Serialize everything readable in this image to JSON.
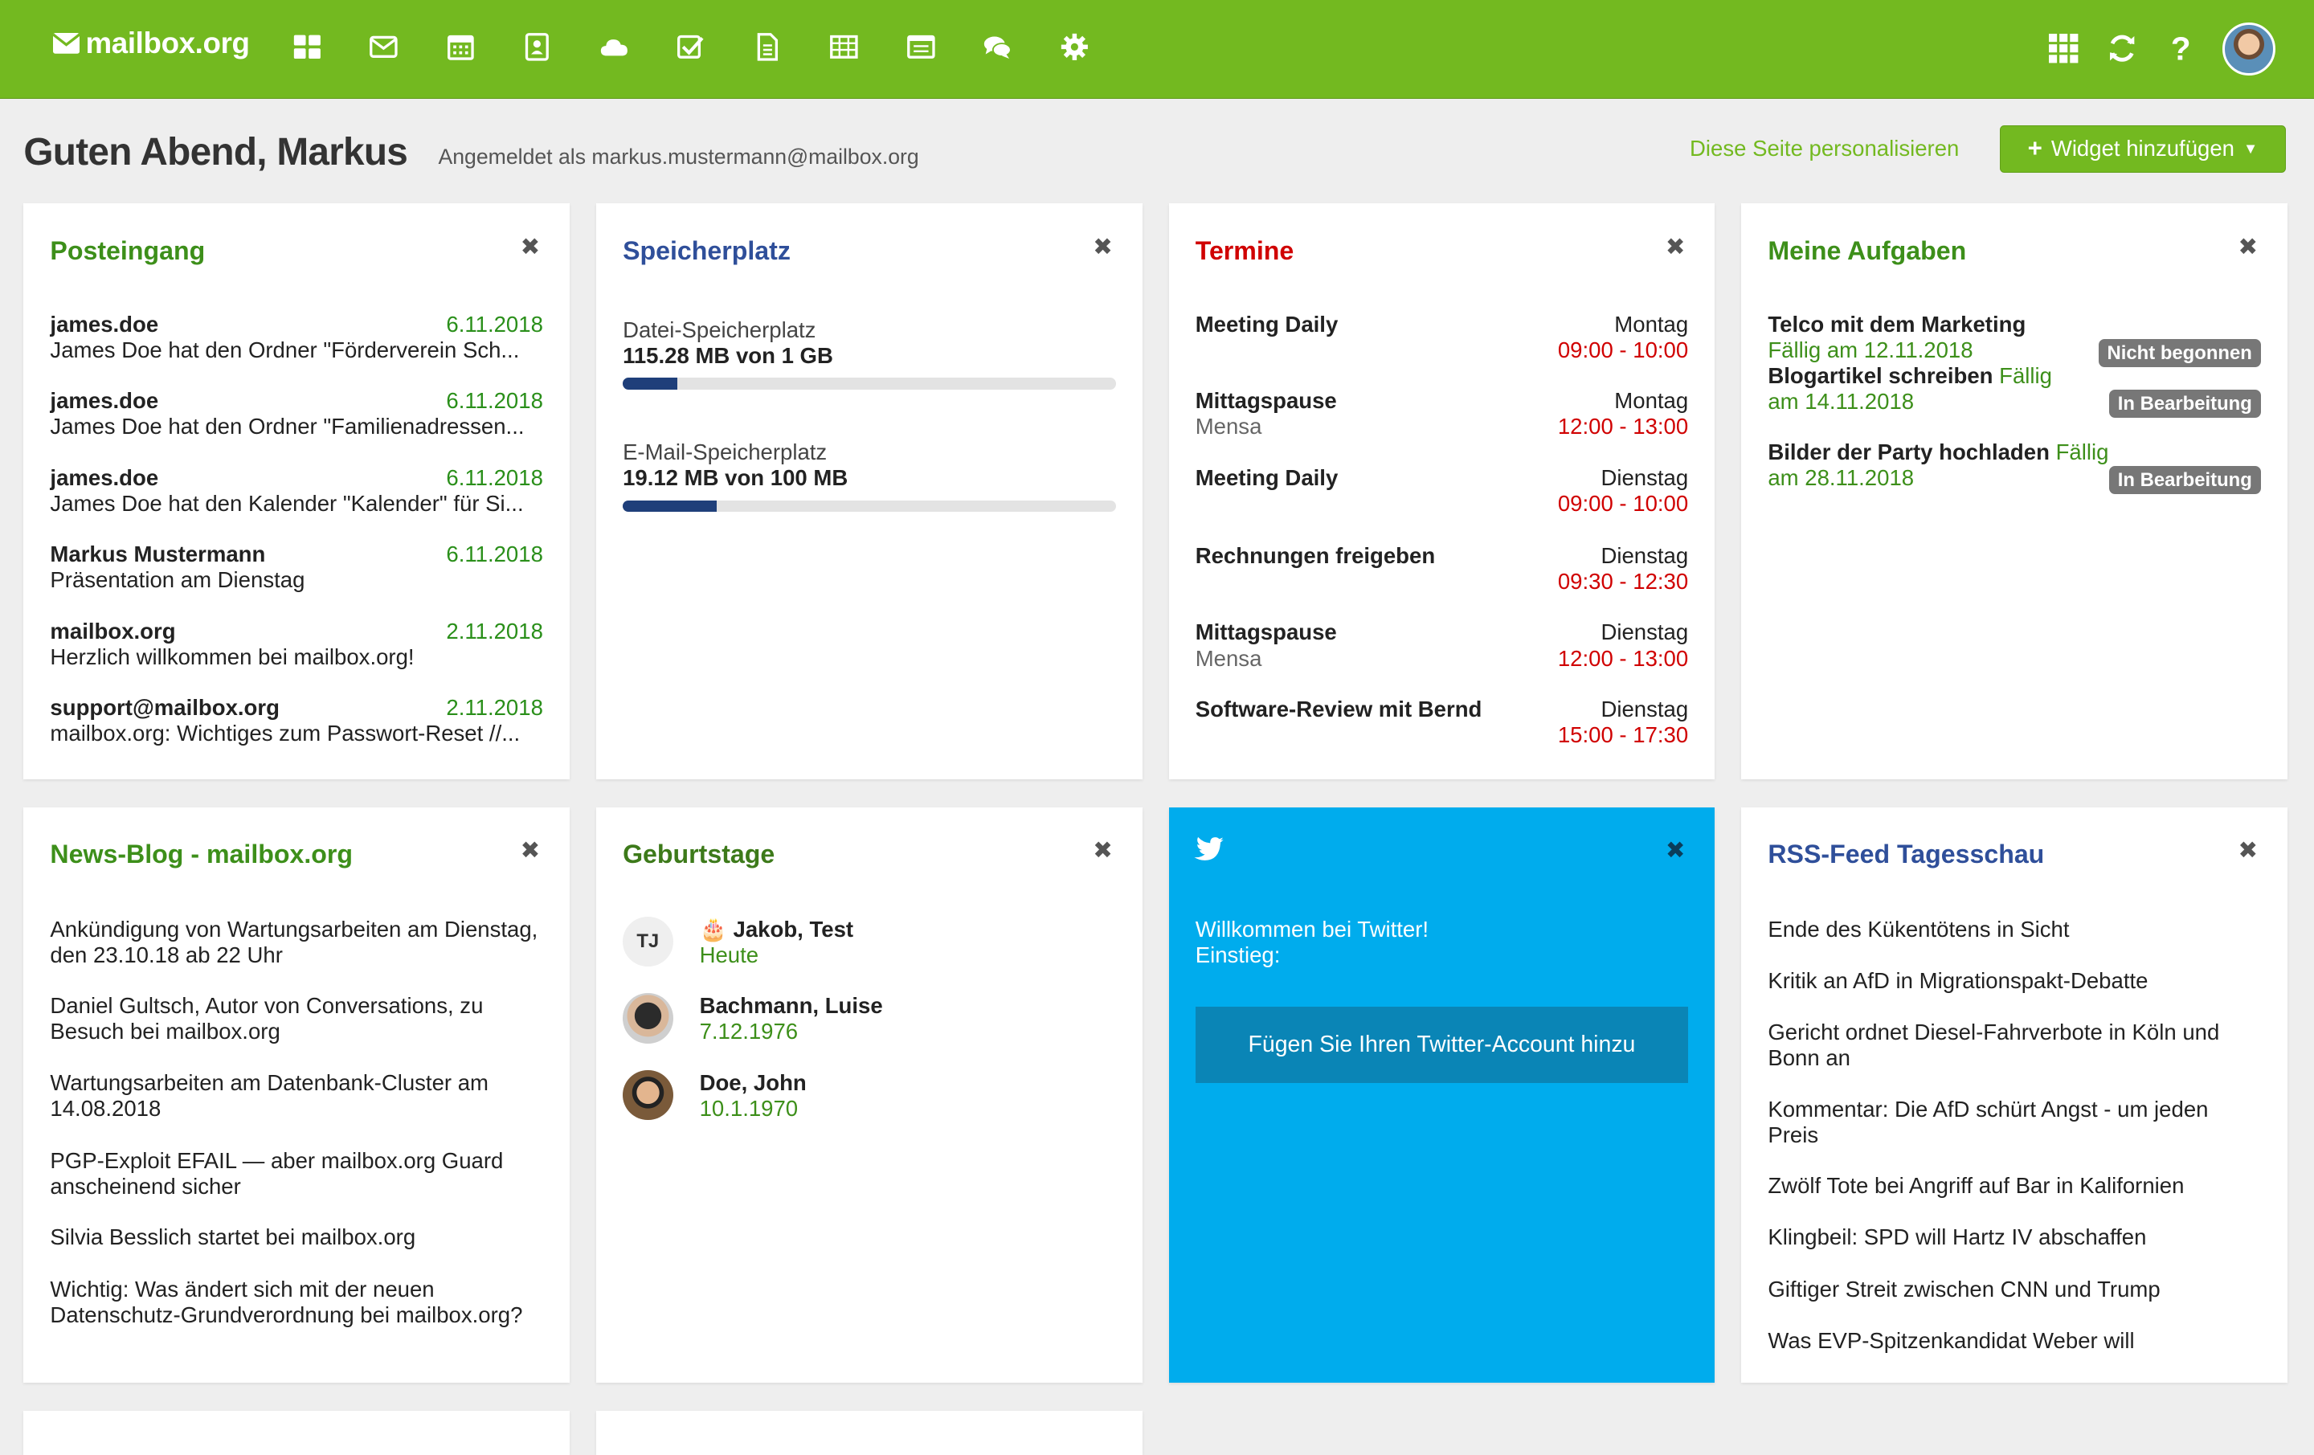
{
  "app": {
    "logo": "mailbox.org"
  },
  "nav": {
    "apps": [
      "portal-icon",
      "mail-icon",
      "calendar-icon",
      "contacts-icon",
      "drive-icon",
      "tasks-icon",
      "text-icon",
      "spreadsheet-icon",
      "presentation-icon",
      "chat-icon",
      "settings-icon"
    ],
    "right": [
      "app-launcher-icon",
      "refresh-icon",
      "help-icon"
    ]
  },
  "header": {
    "greeting": "Guten Abend, Markus",
    "signed_in": "Angemeldet als markus.mustermann@mailbox.org",
    "personalize": "Diese Seite personalisieren",
    "add_widget": "Widget hinzufügen"
  },
  "inbox": {
    "title": "Posteingang",
    "items": [
      {
        "from": "james.doe",
        "date": "6.11.2018",
        "subject": "James Doe hat den Ordner \"Förderverein Sch..."
      },
      {
        "from": "james.doe",
        "date": "6.11.2018",
        "subject": "James Doe hat den Ordner \"Familienadressen..."
      },
      {
        "from": "james.doe",
        "date": "6.11.2018",
        "subject": "James Doe hat den Kalender \"Kalender\" für Si..."
      },
      {
        "from": "Markus Mustermann",
        "date": "6.11.2018",
        "subject": "Präsentation am Dienstag"
      },
      {
        "from": "mailbox.org",
        "date": "2.11.2018",
        "subject": "Herzlich willkommen bei mailbox.org!"
      },
      {
        "from": "support@mailbox.org",
        "date": "2.11.2018",
        "subject": "mailbox.org: Wichtiges zum Passwort-Reset //..."
      }
    ]
  },
  "storage": {
    "title": "Speicherplatz",
    "items": [
      {
        "label": "Datei-Speicherplatz",
        "value": "115.28 MB von 1 GB",
        "fill": 0.11
      },
      {
        "label": "E-Mail-Speicherplatz",
        "value": "19.12 MB von 100 MB",
        "fill": 0.19
      }
    ]
  },
  "appointments": {
    "title": "Termine",
    "items": [
      {
        "title": "Meeting Daily",
        "location": "",
        "day": "Montag",
        "time": "09:00 - 10:00"
      },
      {
        "title": "Mittagspause",
        "location": "Mensa",
        "day": "Montag",
        "time": "12:00 - 13:00"
      },
      {
        "title": "Meeting Daily",
        "location": "",
        "day": "Dienstag",
        "time": "09:00 - 10:00"
      },
      {
        "title": "Rechnungen freigeben",
        "location": "",
        "day": "Dienstag",
        "time": "09:30 - 12:30"
      },
      {
        "title": "Mittagspause",
        "location": "Mensa",
        "day": "Dienstag",
        "time": "12:00 - 13:00"
      },
      {
        "title": "Software-Review mit Bernd",
        "location": "",
        "day": "Dienstag",
        "time": "15:00 - 17:30"
      }
    ]
  },
  "tasks": {
    "title": "Meine Aufgaben",
    "items": [
      {
        "title": "Telco mit dem Marketing",
        "due": "Fällig am 12.11.2018",
        "status": "Nicht begonnen"
      },
      {
        "title": "Blogartikel schreiben",
        "due": "Fällig am 14.11.2018",
        "status": "In Bearbeitung"
      },
      {
        "title": "Bilder der Party hochladen",
        "due": "Fällig am 28.11.2018",
        "status": "In Bearbeitung"
      }
    ]
  },
  "news": {
    "title": "News-Blog - mailbox.org",
    "items": [
      "Ankündigung von Wartungsarbeiten am Dienstag, den 23.10.18 ab 22 Uhr",
      "Daniel Gultsch, Autor von Conversations, zu Besuch bei mailbox.org",
      "Wartungsarbeiten am Datenbank-Cluster am 14.08.2018",
      "PGP-Exploit EFAIL — aber mailbox.org Guard anscheinend sicher",
      "Silvia Besslich startet bei mailbox.org",
      "Wichtig: Was ändert sich mit der neuen Datenschutz-Grundverordnung bei mailbox.org?"
    ]
  },
  "birthdays": {
    "title": "Geburtstage",
    "items": [
      {
        "initials": "TJ",
        "name": "Jakob, Test",
        "date": "Heute",
        "cake": true
      },
      {
        "initials": "",
        "name": "Bachmann, Luise",
        "date": "7.12.1976",
        "cake": false
      },
      {
        "initials": "",
        "name": "Doe, John",
        "date": "10.1.1970",
        "cake": false
      }
    ]
  },
  "twitter": {
    "welcome": "Willkommen bei Twitter!",
    "entry": "Einstieg:",
    "button": "Fügen Sie Ihren Twitter-Account hinzu"
  },
  "rss": {
    "title": "RSS-Feed Tagesschau",
    "items": [
      "Ende des Kükentötens in Sicht",
      "Kritik an AfD in Migrationspakt-Debatte",
      "Gericht ordnet Diesel-Fahrverbote in Köln und Bonn an",
      "Kommentar: Die AfD schürt Angst - um jeden Preis",
      "Zwölf Tote bei Angriff auf Bar in Kalifornien",
      "Klingbeil: SPD will Hartz IV abschaffen",
      "Giftiger Streit zwischen CNN und Trump",
      "Was EVP-Spitzenkandidat Weber will"
    ]
  }
}
